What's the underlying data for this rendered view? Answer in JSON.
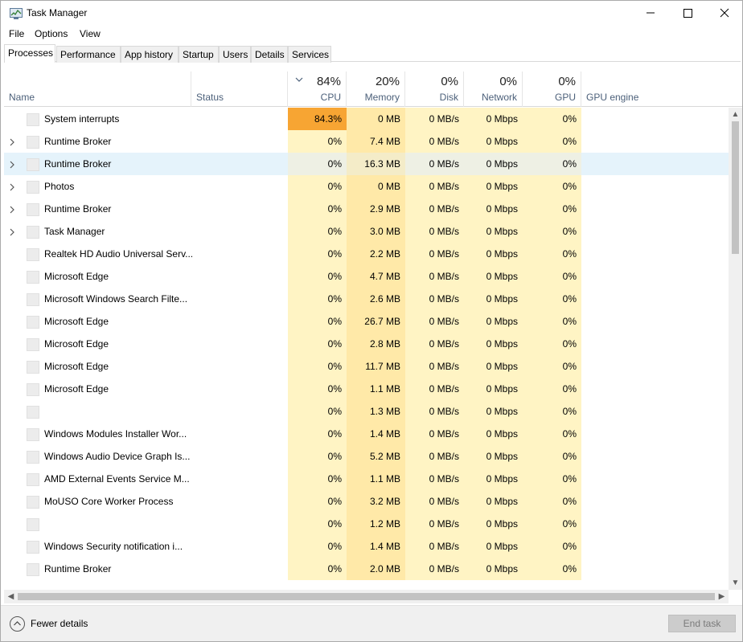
{
  "window": {
    "title": "Task Manager",
    "app_icon": "task-manager-icon"
  },
  "menu": {
    "items": [
      "File",
      "Options",
      "View"
    ]
  },
  "tabs": [
    {
      "label": "Processes",
      "active": true
    },
    {
      "label": "Performance"
    },
    {
      "label": "App history"
    },
    {
      "label": "Startup"
    },
    {
      "label": "Users"
    },
    {
      "label": "Details"
    },
    {
      "label": "Services"
    }
  ],
  "columns": {
    "name": "Name",
    "status": "Status",
    "cpu": {
      "pct": "84%",
      "label": "CPU",
      "sort_icon": "chevron-down-icon"
    },
    "memory": {
      "pct": "20%",
      "label": "Memory"
    },
    "disk": {
      "pct": "0%",
      "label": "Disk"
    },
    "network": {
      "pct": "0%",
      "label": "Network"
    },
    "gpu": {
      "pct": "0%",
      "label": "GPU"
    },
    "gpu_engine": "GPU engine"
  },
  "colors": {
    "cpu_hot": "#f7a533",
    "heat_light": "#fff4c4",
    "heat_mem": "#ffe9a8",
    "selected_row": "#e5f3fb"
  },
  "processes": [
    {
      "name": "System interrupts",
      "expand": false,
      "cpu": "84.3%",
      "mem": "0 MB",
      "disk": "0 MB/s",
      "net": "0 Mbps",
      "gpu": "0%"
    },
    {
      "name": "Runtime Broker",
      "expand": true,
      "cpu": "0%",
      "mem": "7.4 MB",
      "disk": "0 MB/s",
      "net": "0 Mbps",
      "gpu": "0%"
    },
    {
      "name": "Runtime Broker",
      "expand": true,
      "cpu": "0%",
      "mem": "16.3 MB",
      "disk": "0 MB/s",
      "net": "0 Mbps",
      "gpu": "0%",
      "selected": true
    },
    {
      "name": "Photos",
      "expand": true,
      "cpu": "0%",
      "mem": "0 MB",
      "disk": "0 MB/s",
      "net": "0 Mbps",
      "gpu": "0%"
    },
    {
      "name": "Runtime Broker",
      "expand": true,
      "cpu": "0%",
      "mem": "2.9 MB",
      "disk": "0 MB/s",
      "net": "0 Mbps",
      "gpu": "0%"
    },
    {
      "name": "Task Manager",
      "expand": true,
      "cpu": "0%",
      "mem": "3.0 MB",
      "disk": "0 MB/s",
      "net": "0 Mbps",
      "gpu": "0%"
    },
    {
      "name": "Realtek HD Audio Universal Serv...",
      "expand": false,
      "cpu": "0%",
      "mem": "2.2 MB",
      "disk": "0 MB/s",
      "net": "0 Mbps",
      "gpu": "0%"
    },
    {
      "name": "Microsoft Edge",
      "expand": false,
      "cpu": "0%",
      "mem": "4.7 MB",
      "disk": "0 MB/s",
      "net": "0 Mbps",
      "gpu": "0%"
    },
    {
      "name": "Microsoft Windows Search Filte...",
      "expand": false,
      "cpu": "0%",
      "mem": "2.6 MB",
      "disk": "0 MB/s",
      "net": "0 Mbps",
      "gpu": "0%"
    },
    {
      "name": "Microsoft Edge",
      "expand": false,
      "cpu": "0%",
      "mem": "26.7 MB",
      "disk": "0 MB/s",
      "net": "0 Mbps",
      "gpu": "0%"
    },
    {
      "name": "Microsoft Edge",
      "expand": false,
      "cpu": "0%",
      "mem": "2.8 MB",
      "disk": "0 MB/s",
      "net": "0 Mbps",
      "gpu": "0%"
    },
    {
      "name": "Microsoft Edge",
      "expand": false,
      "cpu": "0%",
      "mem": "11.7 MB",
      "disk": "0 MB/s",
      "net": "0 Mbps",
      "gpu": "0%"
    },
    {
      "name": "Microsoft Edge",
      "expand": false,
      "cpu": "0%",
      "mem": "1.1 MB",
      "disk": "0 MB/s",
      "net": "0 Mbps",
      "gpu": "0%"
    },
    {
      "name": "",
      "expand": false,
      "cpu": "0%",
      "mem": "1.3 MB",
      "disk": "0 MB/s",
      "net": "0 Mbps",
      "gpu": "0%"
    },
    {
      "name": "Windows Modules Installer Wor...",
      "expand": false,
      "cpu": "0%",
      "mem": "1.4 MB",
      "disk": "0 MB/s",
      "net": "0 Mbps",
      "gpu": "0%"
    },
    {
      "name": "Windows Audio Device Graph Is...",
      "expand": false,
      "cpu": "0%",
      "mem": "5.2 MB",
      "disk": "0 MB/s",
      "net": "0 Mbps",
      "gpu": "0%"
    },
    {
      "name": "AMD External Events Service M...",
      "expand": false,
      "cpu": "0%",
      "mem": "1.1 MB",
      "disk": "0 MB/s",
      "net": "0 Mbps",
      "gpu": "0%"
    },
    {
      "name": "MoUSO Core Worker Process",
      "expand": false,
      "cpu": "0%",
      "mem": "3.2 MB",
      "disk": "0 MB/s",
      "net": "0 Mbps",
      "gpu": "0%"
    },
    {
      "name": "",
      "expand": false,
      "cpu": "0%",
      "mem": "1.2 MB",
      "disk": "0 MB/s",
      "net": "0 Mbps",
      "gpu": "0%"
    },
    {
      "name": "Windows Security notification i...",
      "expand": false,
      "cpu": "0%",
      "mem": "1.4 MB",
      "disk": "0 MB/s",
      "net": "0 Mbps",
      "gpu": "0%"
    },
    {
      "name": "Runtime Broker",
      "expand": false,
      "cpu": "0%",
      "mem": "2.0 MB",
      "disk": "0 MB/s",
      "net": "0 Mbps",
      "gpu": "0%"
    }
  ],
  "footer": {
    "fewer_details": "Fewer details",
    "end_task": "End task"
  }
}
